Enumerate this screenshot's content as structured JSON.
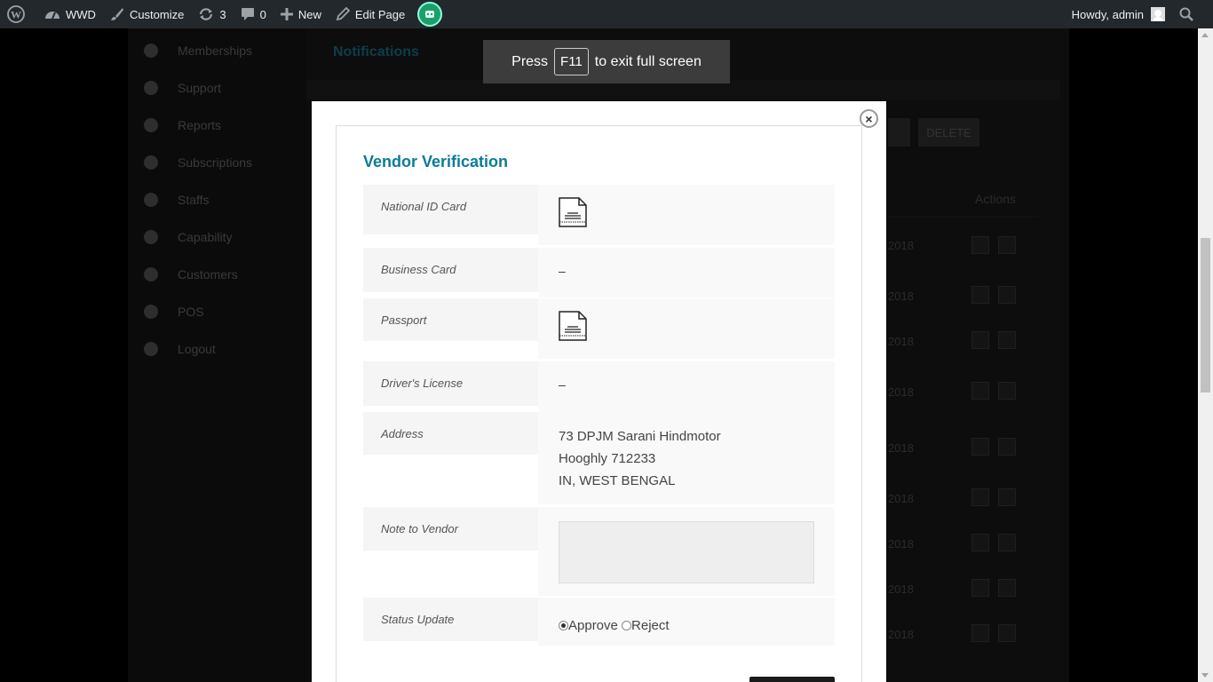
{
  "adminbar": {
    "site_name": "WWD",
    "customize": "Customize",
    "updates_count": "3",
    "comments_count": "0",
    "new": "New",
    "edit_page": "Edit Page",
    "howdy": "Howdy, admin"
  },
  "fullscreen_toast": {
    "pre": "Press",
    "key": "F11",
    "post": "to exit full screen"
  },
  "background": {
    "sidebar_items": [
      "Memberships",
      "Support",
      "Reports",
      "Subscriptions",
      "Staffs",
      "Capability",
      "Customers",
      "POS",
      "Logout"
    ],
    "notifications_title": "Notifications",
    "delete_button": "DELETE",
    "actions_header": "Actions",
    "year": "2018"
  },
  "modal": {
    "title": "Vendor Verification",
    "close_symbol": "×",
    "rows": {
      "national_id": {
        "label": "National ID Card",
        "icon": "document-icon"
      },
      "business_card": {
        "label": "Business Card",
        "value": "–"
      },
      "passport": {
        "label": "Passport",
        "icon": "document-icon"
      },
      "drivers_license": {
        "label": "Driver's License",
        "value": "–"
      },
      "address": {
        "label": "Address",
        "lines": [
          "73 DPJM Sarani Hindmotor",
          "Hooghly 712233",
          "IN, WEST BENGAL"
        ]
      },
      "note": {
        "label": "Note to Vendor",
        "value": ""
      },
      "status": {
        "label": "Status Update",
        "approve": "Approve",
        "reject": "Reject",
        "selected": "Approve"
      }
    }
  }
}
